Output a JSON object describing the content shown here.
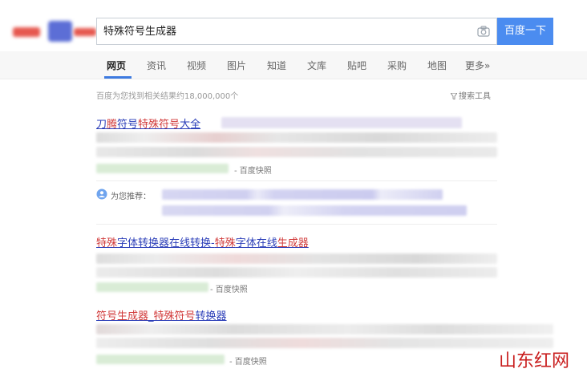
{
  "search": {
    "query": "特殊符号生成器",
    "button_label": "百度一下"
  },
  "nav": {
    "tabs": [
      "网页",
      "资讯",
      "视频",
      "图片",
      "知道",
      "文库",
      "贴吧",
      "采购",
      "地图",
      "更多»"
    ],
    "active": "网页"
  },
  "results_info": {
    "stats": "百度为您找到相关结果约18,000,000个",
    "tools": "搜索工具"
  },
  "results": [
    {
      "title_parts": [
        "刀",
        "腾",
        "符号",
        "特殊符号",
        "大全"
      ],
      "cache_label": "- 百度快照"
    },
    {
      "title_parts": [
        "特殊",
        "字体转换器在线转换",
        "-",
        "特殊",
        "字体在线",
        "生成器"
      ],
      "cache_label": "- 百度快照"
    },
    {
      "title_parts": [
        "符号生成器",
        "_",
        "特殊符号",
        "转换器"
      ],
      "cache_label": "- 百度快照"
    }
  ],
  "recommend": {
    "label": "为您推荐："
  },
  "watermark": "山东红网",
  "colors": {
    "link": "#2a3db8",
    "highlight": "#d13a3a",
    "button": "#4b8cf0"
  }
}
